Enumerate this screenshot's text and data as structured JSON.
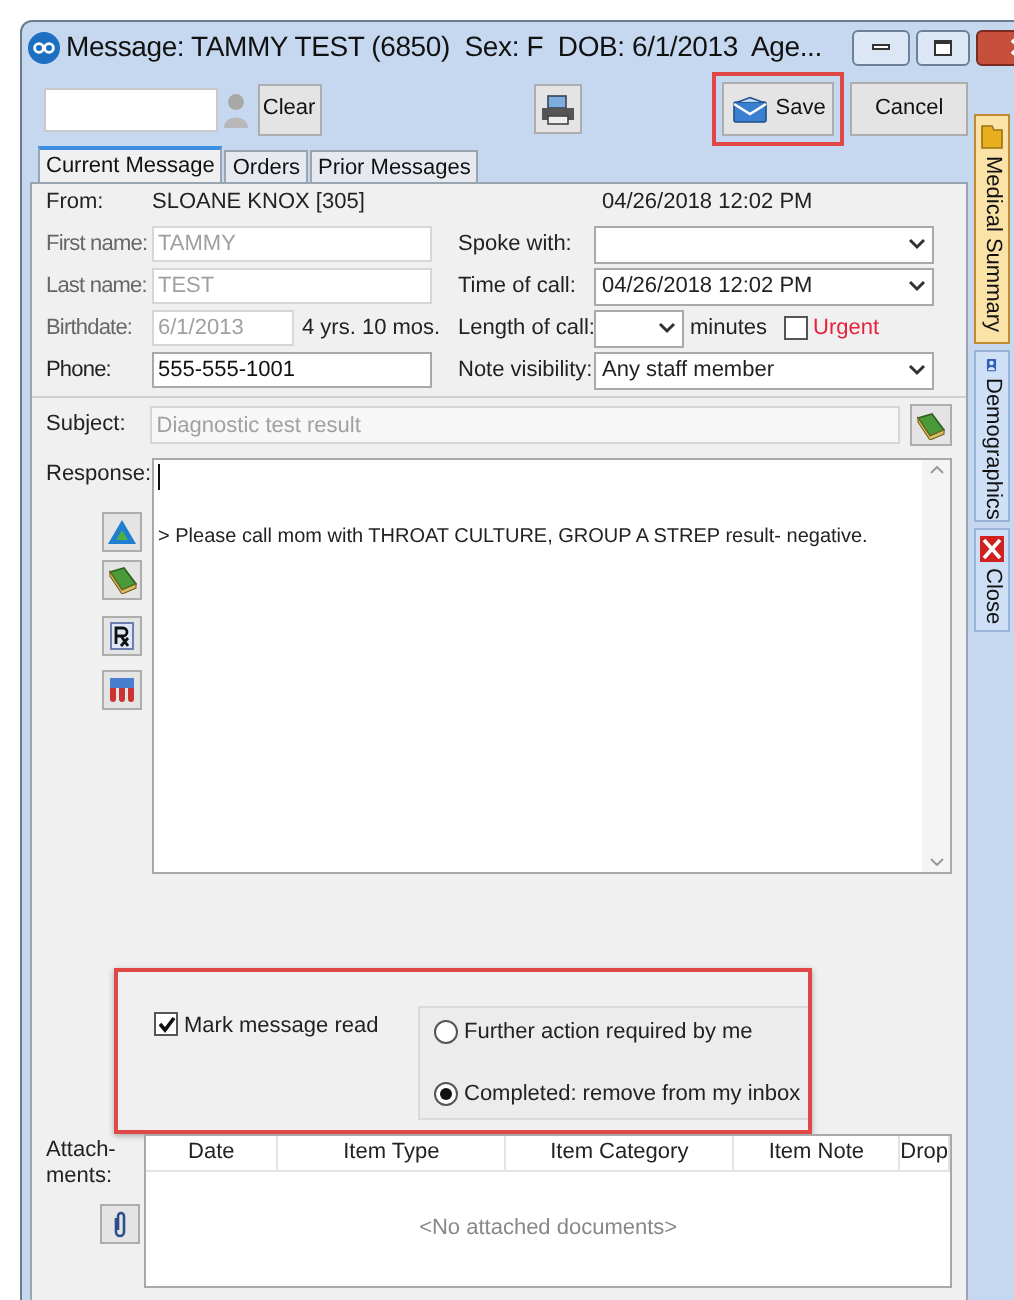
{
  "window": {
    "title": "Message: TAMMY TEST (6850)  Sex: F  DOB: 6/1/2013  Age..."
  },
  "toolbar": {
    "clear_button": "Clear",
    "save_button": {
      "label": "Save",
      "highlighted": true
    },
    "cancel_button": "Cancel"
  },
  "tabs": [
    {
      "label": "Current Message",
      "selected": true
    },
    {
      "label": "Orders",
      "selected": false
    },
    {
      "label": "Prior Messages",
      "selected": false
    }
  ],
  "from": {
    "label": "From:",
    "value": "SLOANE KNOX [305]",
    "timestamp": "04/26/2018 12:02 PM"
  },
  "patient_fields": [
    {
      "label": "First name:",
      "value": "TAMMY",
      "disabled": true
    },
    {
      "label": "Last name:",
      "value": "TEST",
      "disabled": true
    },
    {
      "label": "Birthdate:",
      "value": "6/1/2013",
      "disabled": true,
      "note": "4 yrs. 10 mos."
    },
    {
      "label": "Phone:",
      "value": "555-555-1001",
      "disabled": false
    }
  ],
  "call_fields": [
    {
      "kind": "dropdown",
      "label": "Spoke with:"
    },
    {
      "kind": "dropdown",
      "label": "Time of call:",
      "value": "04/26/2018 12:02 PM"
    },
    {
      "kind": "length",
      "label": "Length of call:",
      "unit": "minutes",
      "urgent": {
        "label": "Urgent",
        "checked": false
      }
    },
    {
      "kind": "dropdown",
      "label": "Note visibility:",
      "value": "Any staff member"
    }
  ],
  "subject": {
    "label": "Subject:",
    "value": "Diagnostic test result",
    "disabled": true
  },
  "response": {
    "label": "Response:",
    "text": "> Please call mom with THROAT CULTURE, GROUP A STREP result- negative."
  },
  "completion": {
    "highlighted": true,
    "mark_read": {
      "label": "Mark message read",
      "checked": true
    },
    "options": [
      {
        "label": "Further action required by me",
        "selected": false
      },
      {
        "label": "Completed: remove from my inbox",
        "selected": true
      }
    ]
  },
  "attachments": {
    "label": "Attach-ments:",
    "columns": [
      "Date",
      "Item Type",
      "Item Category",
      "Item Note",
      "Drop"
    ],
    "empty_text": "<No attached documents>"
  },
  "side_tabs": [
    {
      "label": "Medical Summary",
      "kind": "folder",
      "selected": true
    },
    {
      "label": "Demographics",
      "kind": "person",
      "selected": false
    },
    {
      "label": "Close",
      "kind": "close",
      "selected": false
    }
  ]
}
